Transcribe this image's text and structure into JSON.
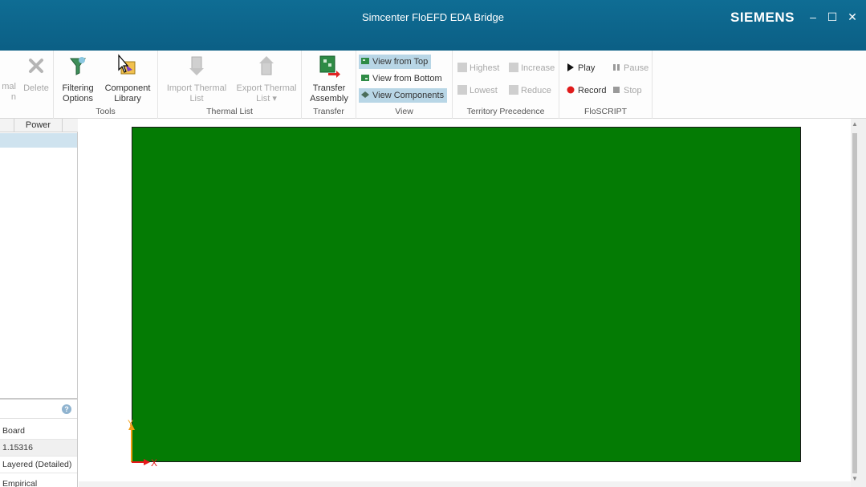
{
  "window": {
    "title": "Simcenter FloEFD EDA Bridge",
    "brand": "SIEMENS",
    "minimize": "–",
    "maximize": "☐",
    "close": "✕"
  },
  "ribbon": {
    "edit": {
      "partial_label_1": "mal",
      "partial_label_2": "n",
      "delete_label": "Delete"
    },
    "tools": {
      "label": "Tools",
      "filtering_options_1": "Filtering",
      "filtering_options_2": "Options",
      "component_library_1": "Component",
      "component_library_2": "Library"
    },
    "thermal_list": {
      "label": "Thermal List",
      "import_1": "Import Thermal",
      "import_2": "List",
      "export_1": "Export Thermal",
      "export_2": "List ▾"
    },
    "transfer": {
      "label": "Transfer",
      "transfer_assembly_1": "Transfer",
      "transfer_assembly_2": "Assembly"
    },
    "view": {
      "label": "View",
      "view_from_top": "View from Top",
      "view_from_bottom": "View from Bottom",
      "view_components": "View Components"
    },
    "territory": {
      "label": "Territory Precedence",
      "highest": "Highest",
      "increase": "Increase",
      "lowest": "Lowest",
      "reduce": "Reduce"
    },
    "floscript": {
      "label": "FloSCRIPT",
      "play": "Play",
      "pause": "Pause",
      "record": "Record",
      "stop": "Stop"
    }
  },
  "left_panel": {
    "table": {
      "column_power": "Power"
    },
    "properties": {
      "help": "?",
      "rows": [
        "Board",
        "1.15316",
        "Layered (Detailed)",
        "Empirical"
      ]
    }
  },
  "viewport": {
    "axis_x": "X",
    "axis_y": "Y"
  },
  "colors": {
    "titlebar": "#0b5f85",
    "board": "#047b04",
    "selection": "#cfe3ef",
    "active_view": "#b8d6e6",
    "axis_x": "#e8181b",
    "axis_y": "#f39c12"
  }
}
